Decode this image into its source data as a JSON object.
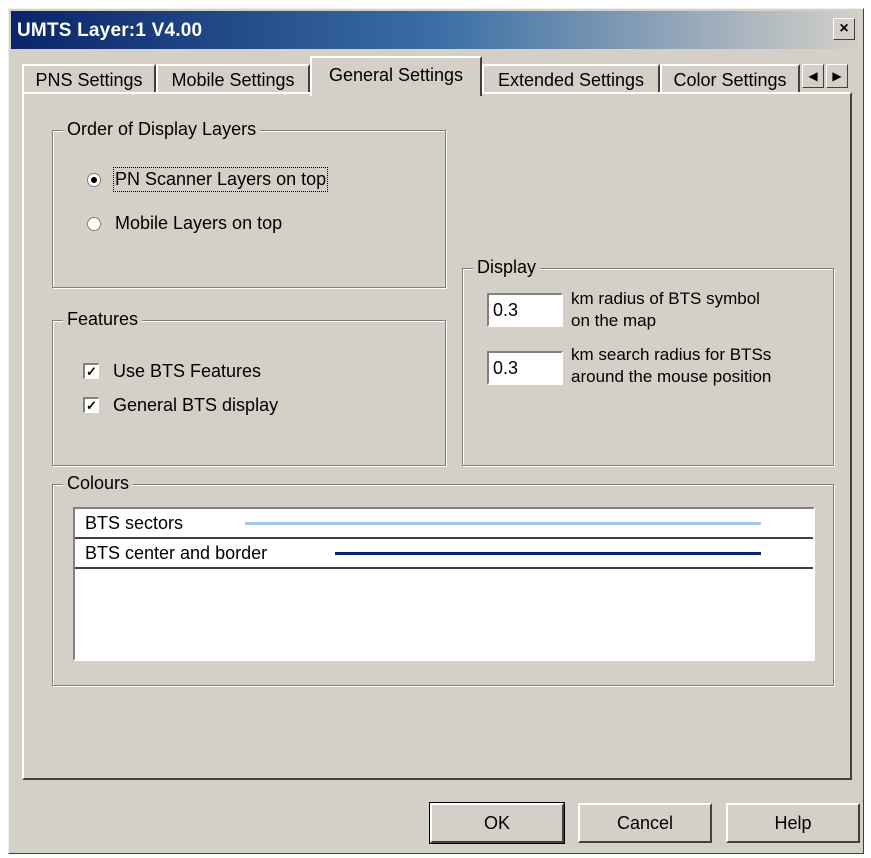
{
  "window": {
    "title": "UMTS Layer:1 V4.00",
    "close_glyph": "×"
  },
  "tabs": [
    {
      "label": "PNS Settings"
    },
    {
      "label": "Mobile Settings"
    },
    {
      "label": "General Settings"
    },
    {
      "label": "Extended Settings"
    },
    {
      "label": "Color Settings"
    }
  ],
  "active_tab": "General Settings",
  "tab_scroll": {
    "left_icon": "arrow-left-icon",
    "right_icon": "arrow-right-icon",
    "left_glyph": "◀",
    "right_glyph": "▶"
  },
  "order_group": {
    "title": "Order of Display Layers",
    "options": [
      {
        "label": "PN Scanner Layers on top",
        "selected": true
      },
      {
        "label": "Mobile Layers on top",
        "selected": false
      }
    ]
  },
  "features_group": {
    "title": "Features",
    "options": [
      {
        "label": "Use BTS Features",
        "checked": true
      },
      {
        "label": "General BTS display",
        "checked": true
      }
    ],
    "check_glyph": "✓"
  },
  "display_group": {
    "title": "Display",
    "fields": [
      {
        "value": "0.3",
        "line1": "km  radius of BTS symbol",
        "line2": "on the map"
      },
      {
        "value": "0.3",
        "line1": "km  search radius for BTSs",
        "line2": "around the mouse position"
      }
    ]
  },
  "colours_group": {
    "title": "Colours",
    "items": [
      {
        "label": "BTS sectors",
        "color": "#a8c4f0"
      },
      {
        "label": "BTS center and border",
        "color": "#0a2470"
      }
    ]
  },
  "buttons": {
    "ok": "OK",
    "cancel": "Cancel",
    "help": "Help"
  },
  "colors": {
    "title_bar_start": "#0a246a",
    "dialog_bg": "#d4d0c8"
  }
}
